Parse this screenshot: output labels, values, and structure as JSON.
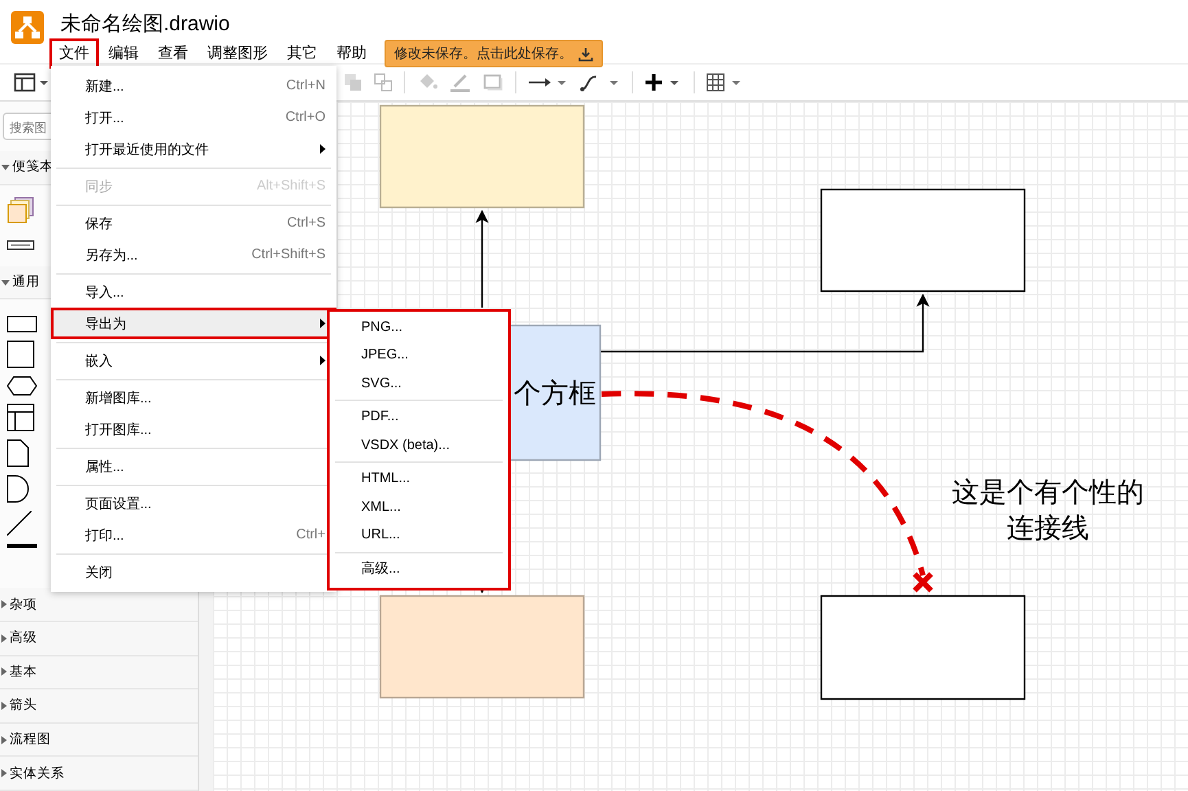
{
  "window": {
    "title": "未命名绘图.drawio"
  },
  "menubar": [
    {
      "label": "文件",
      "selected": true
    },
    {
      "label": "编辑",
      "selected": false
    },
    {
      "label": "查看",
      "selected": false
    },
    {
      "label": "调整图形",
      "selected": false
    },
    {
      "label": "其它",
      "selected": false
    },
    {
      "label": "帮助",
      "selected": false
    }
  ],
  "save_notice": "修改未保存。点击此处保存。",
  "sidebar": {
    "search": {
      "placeholder": "搜索图"
    },
    "sections": [
      {
        "label": "便笺本",
        "expanded": true,
        "kind": "scratchpad"
      },
      {
        "label": "通用",
        "expanded": true,
        "kind": "shapes"
      },
      {
        "label": "杂项",
        "expanded": false
      },
      {
        "label": "高级",
        "expanded": false
      },
      {
        "label": "基本",
        "expanded": false
      },
      {
        "label": "箭头",
        "expanded": false
      },
      {
        "label": "流程图",
        "expanded": false
      },
      {
        "label": "实体关系",
        "expanded": false
      }
    ]
  },
  "file_menu": [
    {
      "kind": "item",
      "label": "新建...",
      "shortcut": "Ctrl+N",
      "disabled": false,
      "selected": false
    },
    {
      "kind": "item",
      "label": "打开...",
      "shortcut": "Ctrl+O",
      "disabled": false,
      "selected": false
    },
    {
      "kind": "submenu",
      "label": "打开最近使用的文件",
      "disabled": false,
      "selected": false
    },
    {
      "kind": "separator"
    },
    {
      "kind": "item",
      "label": "同步",
      "shortcut": "Alt+Shift+S",
      "disabled": true,
      "selected": false
    },
    {
      "kind": "separator"
    },
    {
      "kind": "item",
      "label": "保存",
      "shortcut": "Ctrl+S",
      "disabled": false,
      "selected": false
    },
    {
      "kind": "item",
      "label": "另存为...",
      "shortcut": "Ctrl+Shift+S",
      "disabled": false,
      "selected": false
    },
    {
      "kind": "separator"
    },
    {
      "kind": "item",
      "label": "导入...",
      "disabled": false,
      "selected": false
    },
    {
      "kind": "submenu",
      "label": "导出为",
      "disabled": false,
      "selected": true
    },
    {
      "kind": "separator"
    },
    {
      "kind": "submenu",
      "label": "嵌入",
      "disabled": false,
      "selected": false
    },
    {
      "kind": "separator"
    },
    {
      "kind": "item",
      "label": "新增图库...",
      "disabled": false,
      "selected": false
    },
    {
      "kind": "item",
      "label": "打开图库...",
      "disabled": false,
      "selected": false
    },
    {
      "kind": "separator"
    },
    {
      "kind": "item",
      "label": "属性...",
      "disabled": false,
      "selected": false
    },
    {
      "kind": "separator"
    },
    {
      "kind": "item",
      "label": "页面设置...",
      "disabled": false,
      "selected": false
    },
    {
      "kind": "item",
      "label": "打印...",
      "shortcut": "Ctrl+",
      "disabled": false,
      "selected": false
    },
    {
      "kind": "separator"
    },
    {
      "kind": "item",
      "label": "关闭",
      "disabled": false,
      "selected": false
    }
  ],
  "export_menu": [
    {
      "kind": "item",
      "label": "PNG..."
    },
    {
      "kind": "item",
      "label": "JPEG..."
    },
    {
      "kind": "item",
      "label": "SVG..."
    },
    {
      "kind": "separator"
    },
    {
      "kind": "item",
      "label": "PDF..."
    },
    {
      "kind": "item",
      "label": "VSDX (beta)..."
    },
    {
      "kind": "separator"
    },
    {
      "kind": "item",
      "label": "HTML..."
    },
    {
      "kind": "item",
      "label": "XML..."
    },
    {
      "kind": "item",
      "label": "URL..."
    },
    {
      "kind": "separator"
    },
    {
      "kind": "item",
      "label": "高级..."
    }
  ],
  "canvas": {
    "shapes": [
      {
        "kind": "rect",
        "color": "#fff2cc"
      },
      {
        "kind": "rect",
        "color": "#dae8fc",
        "text": "个方框"
      },
      {
        "kind": "rect",
        "color": "#ffe6cc"
      },
      {
        "kind": "rect",
        "color": "#ffffff"
      },
      {
        "kind": "rect",
        "color": "#ffffff"
      }
    ],
    "connector_label": [
      "这是个有个性的",
      "连接线"
    ]
  }
}
